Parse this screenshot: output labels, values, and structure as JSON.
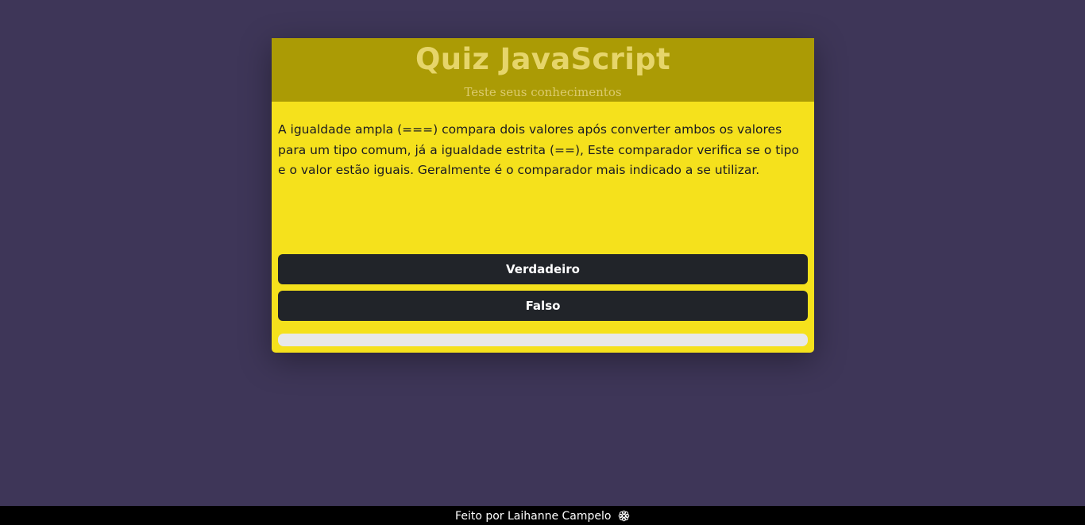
{
  "header": {
    "title": "Quiz JavaScript",
    "subtitle": "Teste seus conhecimentos"
  },
  "question": {
    "text": "A igualdade ampla (===) compara dois valores após converter ambos os valores para um tipo comum, já a igualdade estrita (==), Este comparador verifica se o tipo e o valor estão iguais. Geralmente é o comparador mais indicado a se utilizar."
  },
  "answers": [
    {
      "label": "Verdadeiro"
    },
    {
      "label": "Falso"
    }
  ],
  "progress": {
    "fraction": 0
  },
  "footer": {
    "text": "Feito por Laihanne Campelo",
    "icon": "flower-icon"
  },
  "colors": {
    "page_background": "#3e3658",
    "card_background": "#f5e11c",
    "header_background": "#ab9b05",
    "button_background": "#212429",
    "progress_track": "#e8e8e8",
    "footer_background": "#000000"
  }
}
